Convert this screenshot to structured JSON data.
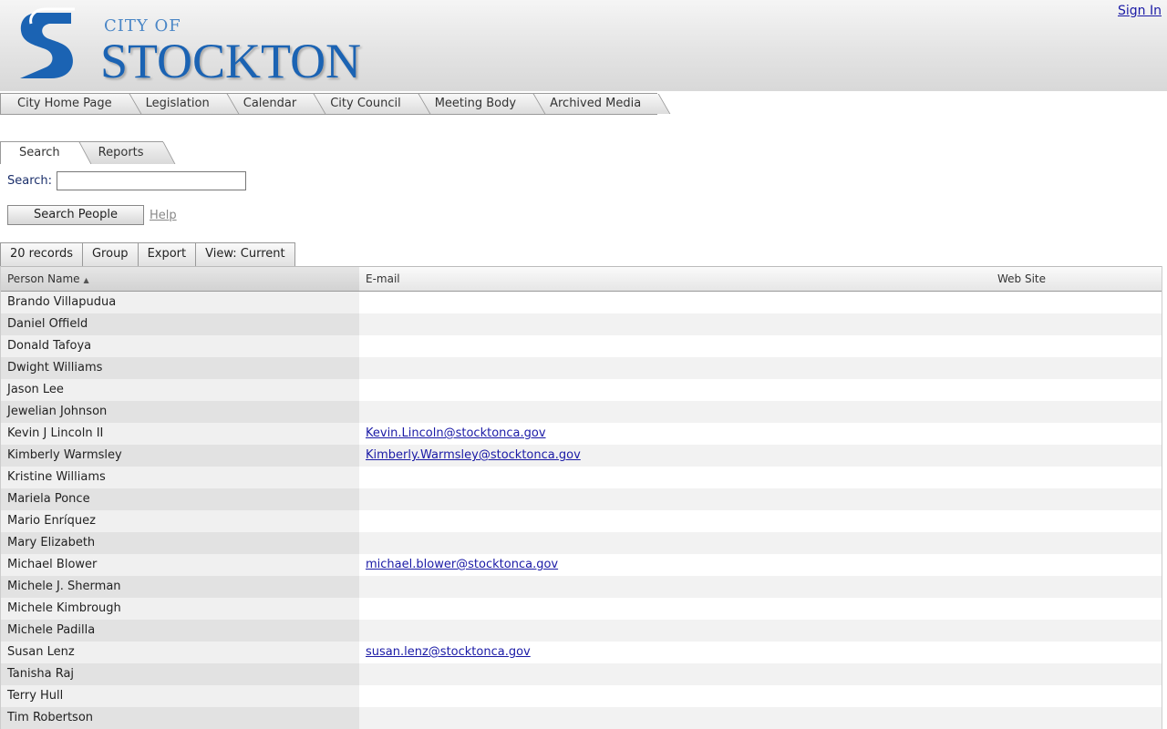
{
  "header": {
    "logo_city": "CITY OF",
    "logo_name": "STOCKTON",
    "sign_in": "Sign In"
  },
  "topnav": [
    "City Home Page",
    "Legislation",
    "Calendar",
    "City Council",
    "Meeting Body",
    "Archived Media"
  ],
  "subtabs": {
    "search": "Search",
    "reports": "Reports"
  },
  "search": {
    "label": "Search:",
    "value": "",
    "button": "Search People",
    "help": "Help"
  },
  "toolbar": {
    "records": "20 records",
    "group": "Group",
    "export": "Export",
    "view": "View: Current"
  },
  "grid": {
    "columns": {
      "name": "Person Name",
      "email": "E-mail",
      "web": "Web Site"
    },
    "rows": [
      {
        "name": "Brando Villapudua",
        "email": "",
        "web": ""
      },
      {
        "name": "Daniel Offield",
        "email": "",
        "web": ""
      },
      {
        "name": "Donald Tafoya",
        "email": "",
        "web": ""
      },
      {
        "name": "Dwight Williams",
        "email": "",
        "web": ""
      },
      {
        "name": "Jason Lee",
        "email": "",
        "web": ""
      },
      {
        "name": "Jewelian Johnson",
        "email": "",
        "web": ""
      },
      {
        "name": "Kevin J Lincoln II",
        "email": "Kevin.Lincoln@stocktonca.gov",
        "web": ""
      },
      {
        "name": "Kimberly Warmsley",
        "email": "Kimberly.Warmsley@stocktonca.gov",
        "web": ""
      },
      {
        "name": "Kristine Williams",
        "email": "",
        "web": ""
      },
      {
        "name": "Mariela Ponce",
        "email": "",
        "web": ""
      },
      {
        "name": "Mario Enríquez",
        "email": "",
        "web": ""
      },
      {
        "name": "Mary Elizabeth",
        "email": "",
        "web": ""
      },
      {
        "name": "Michael Blower",
        "email": "michael.blower@stocktonca.gov",
        "web": ""
      },
      {
        "name": "Michele J. Sherman",
        "email": "",
        "web": ""
      },
      {
        "name": "Michele Kimbrough",
        "email": "",
        "web": ""
      },
      {
        "name": "Michele Padilla",
        "email": "",
        "web": ""
      },
      {
        "name": "Susan Lenz",
        "email": "susan.lenz@stocktonca.gov",
        "web": ""
      },
      {
        "name": "Tanisha Raj",
        "email": "",
        "web": ""
      },
      {
        "name": "Terry Hull",
        "email": "",
        "web": ""
      },
      {
        "name": "Tim Robertson",
        "email": "",
        "web": ""
      }
    ]
  },
  "colors": {
    "brand_blue": "#1b63b3",
    "link": "#1a1aa6"
  }
}
